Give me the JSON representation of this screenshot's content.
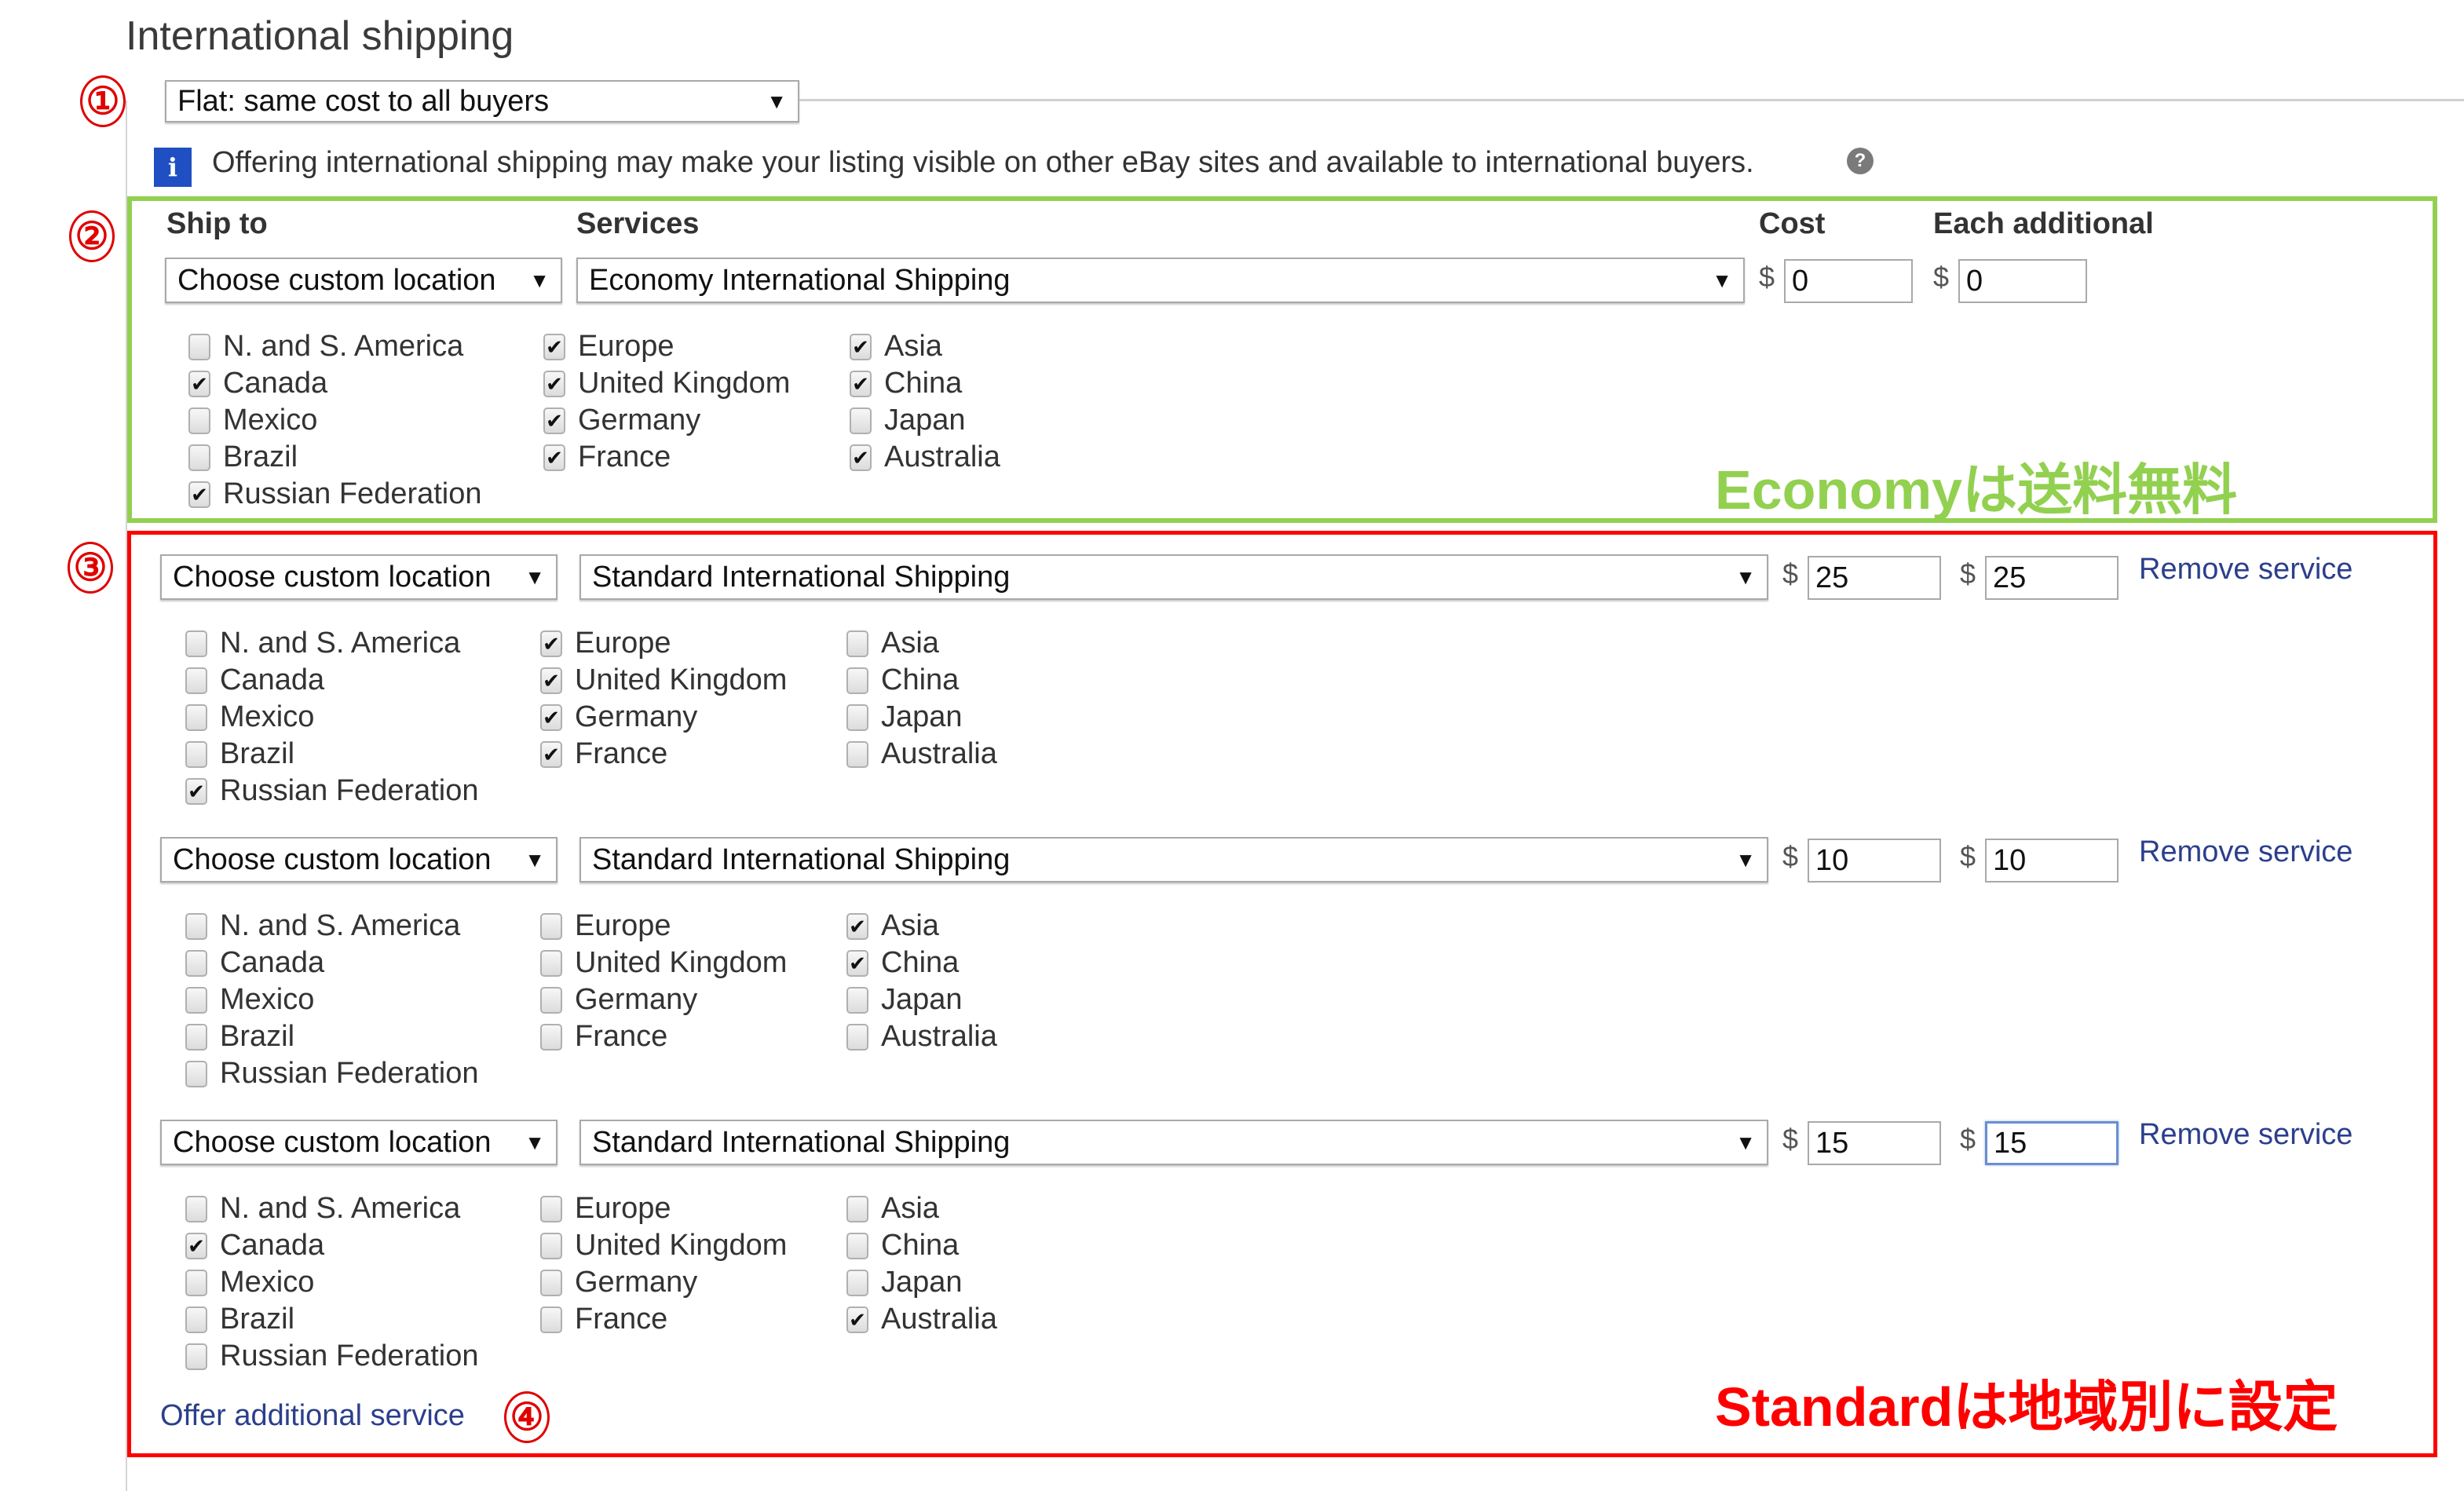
{
  "section_title": "International shipping",
  "shipping_type": {
    "selected": "Flat: same cost to all buyers"
  },
  "info": {
    "icon": "info-icon",
    "text": "Offering international shipping may make your listing visible on other eBay sites and available to international buyers.",
    "help_icon": "question-icon"
  },
  "headers": {
    "ship_to": "Ship to",
    "services": "Services",
    "cost": "Cost",
    "each_additional": "Each additional"
  },
  "currency_symbol": "$",
  "remove_label": "Remove service",
  "offer_additional_label": "Offer additional service",
  "check_mark": "✔",
  "annotations": {
    "markers": [
      "①",
      "②",
      "③",
      "④"
    ],
    "economy_note": "Economyは送料無料",
    "standard_note": "Standardは地域別に設定",
    "colors": {
      "economy": "#92d050",
      "standard": "#ff0000"
    }
  },
  "services": [
    {
      "location": "Choose custom location",
      "service": "Economy International Shipping",
      "cost": "0",
      "each_additional": "0",
      "removable": false,
      "regions": [
        [
          {
            "label": "N. and S. America",
            "checked": false
          },
          {
            "label": "Canada",
            "checked": true
          },
          {
            "label": "Mexico",
            "checked": false
          },
          {
            "label": "Brazil",
            "checked": false
          },
          {
            "label": "Russian Federation",
            "checked": true
          }
        ],
        [
          {
            "label": "Europe",
            "checked": true
          },
          {
            "label": "United Kingdom",
            "checked": true
          },
          {
            "label": "Germany",
            "checked": true
          },
          {
            "label": "France",
            "checked": true
          }
        ],
        [
          {
            "label": "Asia",
            "checked": true
          },
          {
            "label": "China",
            "checked": true
          },
          {
            "label": "Japan",
            "checked": false
          },
          {
            "label": "Australia",
            "checked": true
          }
        ]
      ]
    },
    {
      "location": "Choose custom location",
      "service": "Standard International Shipping",
      "cost": "25",
      "each_additional": "25",
      "removable": true,
      "regions": [
        [
          {
            "label": "N. and S. America",
            "checked": false
          },
          {
            "label": "Canada",
            "checked": false
          },
          {
            "label": "Mexico",
            "checked": false
          },
          {
            "label": "Brazil",
            "checked": false
          },
          {
            "label": "Russian Federation",
            "checked": true
          }
        ],
        [
          {
            "label": "Europe",
            "checked": true
          },
          {
            "label": "United Kingdom",
            "checked": true
          },
          {
            "label": "Germany",
            "checked": true
          },
          {
            "label": "France",
            "checked": true
          }
        ],
        [
          {
            "label": "Asia",
            "checked": false
          },
          {
            "label": "China",
            "checked": false
          },
          {
            "label": "Japan",
            "checked": false
          },
          {
            "label": "Australia",
            "checked": false
          }
        ]
      ]
    },
    {
      "location": "Choose custom location",
      "service": "Standard International Shipping",
      "cost": "10",
      "each_additional": "10",
      "removable": true,
      "regions": [
        [
          {
            "label": "N. and S. America",
            "checked": false
          },
          {
            "label": "Canada",
            "checked": false
          },
          {
            "label": "Mexico",
            "checked": false
          },
          {
            "label": "Brazil",
            "checked": false
          },
          {
            "label": "Russian Federation",
            "checked": false
          }
        ],
        [
          {
            "label": "Europe",
            "checked": false
          },
          {
            "label": "United Kingdom",
            "checked": false
          },
          {
            "label": "Germany",
            "checked": false
          },
          {
            "label": "France",
            "checked": false
          }
        ],
        [
          {
            "label": "Asia",
            "checked": true
          },
          {
            "label": "China",
            "checked": true
          },
          {
            "label": "Japan",
            "checked": false
          },
          {
            "label": "Australia",
            "checked": false
          }
        ]
      ]
    },
    {
      "location": "Choose custom location",
      "service": "Standard International Shipping",
      "cost": "15",
      "each_additional": "15",
      "removable": true,
      "focused_field": "each_additional",
      "regions": [
        [
          {
            "label": "N. and S. America",
            "checked": false
          },
          {
            "label": "Canada",
            "checked": true
          },
          {
            "label": "Mexico",
            "checked": false
          },
          {
            "label": "Brazil",
            "checked": false
          },
          {
            "label": "Russian Federation",
            "checked": false
          }
        ],
        [
          {
            "label": "Europe",
            "checked": false
          },
          {
            "label": "United Kingdom",
            "checked": false
          },
          {
            "label": "Germany",
            "checked": false
          },
          {
            "label": "France",
            "checked": false
          }
        ],
        [
          {
            "label": "Asia",
            "checked": false
          },
          {
            "label": "China",
            "checked": false
          },
          {
            "label": "Japan",
            "checked": false
          },
          {
            "label": "Australia",
            "checked": true
          }
        ]
      ]
    }
  ]
}
